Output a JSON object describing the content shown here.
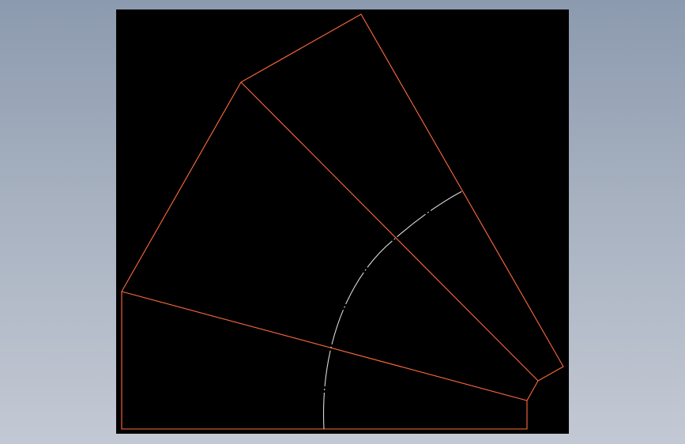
{
  "scene": {
    "background_color": "#000000",
    "line_color": "#ff6a3d",
    "centerline_color": "#d9d9d9",
    "description_icon": "cad-drawing"
  }
}
